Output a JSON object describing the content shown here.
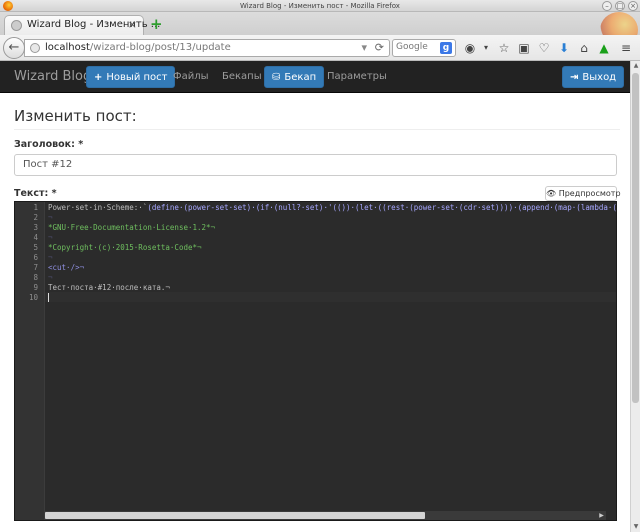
{
  "window": {
    "title": "Wizard Blog - Изменить пост - Mozilla Firefox"
  },
  "browser": {
    "tab_label": "Wizard Blog - Изменить ...",
    "url_host": "localhost",
    "url_path": "/wizard-blog/post/13/update",
    "search_engine": "Google",
    "search_icon_letter": "g"
  },
  "navbar": {
    "brand": "Wizard Blog",
    "new_post": "Новый пост",
    "files": "Файлы",
    "backups": "Бекапы",
    "backup": "Бекап",
    "settings": "Параметры",
    "logout": "Выход"
  },
  "page": {
    "header": "Изменить пост:",
    "title_label": "Заголовок: *",
    "title_value": "Пост #12",
    "text_label": "Текст: *",
    "preview_button": "Предпросмотр"
  },
  "editor": {
    "line_numbers": [
      "1",
      "2",
      "3",
      "4",
      "5",
      "6",
      "7",
      "8",
      "9",
      "10"
    ],
    "line1_plain": "Power·set·in·Scheme:·`",
    "line1_code": "(define·(power-set·set)·(if·(null?·set)·'(())·(let·((rest·(power-set·(cdr·set))))·(append·(map·(lambda·(e",
    "line2": "¬",
    "line3": "*GNU·Free·Documentation·License·1.2*¬",
    "line4": "¬",
    "line5": "*Copyright·(c)·2015·Rosetta·Code*¬",
    "line6": "¬",
    "line7": "<cut·/>¬",
    "line8": "¬",
    "line9": "Тест·поста·#12·после·ката.¬",
    "line10": ""
  }
}
